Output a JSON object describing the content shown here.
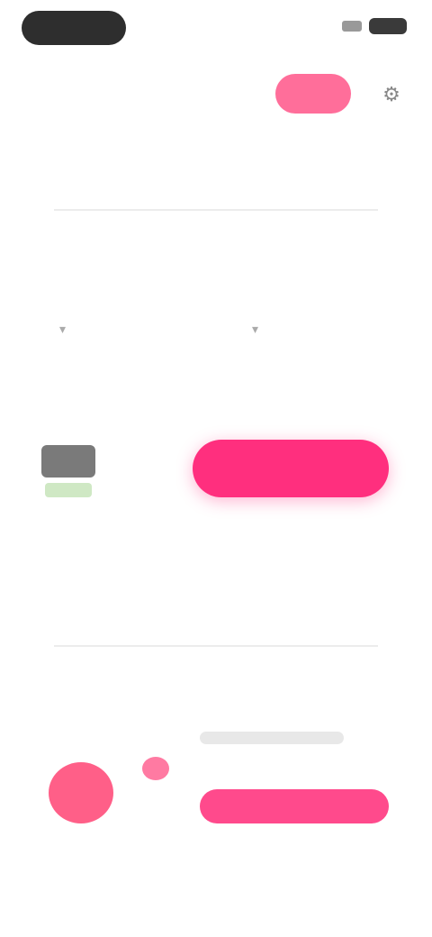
{
  "status_bar": {
    "time": "",
    "battery": ""
  },
  "header": {
    "title": "",
    "subtitle": "",
    "action_button": "",
    "settings_icon": "gear-icon"
  },
  "tabs": [
    {
      "label": "",
      "active": false
    },
    {
      "label": "",
      "active": true
    },
    {
      "label": "",
      "active": false
    }
  ],
  "filters": [
    {
      "label": ""
    },
    {
      "label": ""
    }
  ],
  "section_one": {
    "title": "",
    "rate_value": "",
    "rate_sub": "",
    "cta_label": ""
  },
  "section_two": {
    "title": "",
    "card_line": "",
    "card_button": ""
  },
  "bottom_nav": [
    {
      "label": ""
    },
    {
      "label": ""
    },
    {
      "label": ""
    },
    {
      "label": ""
    },
    {
      "label": ""
    }
  ],
  "colors": {
    "accent": "#ff2f7e",
    "accent_light": "#ff6e9a"
  }
}
